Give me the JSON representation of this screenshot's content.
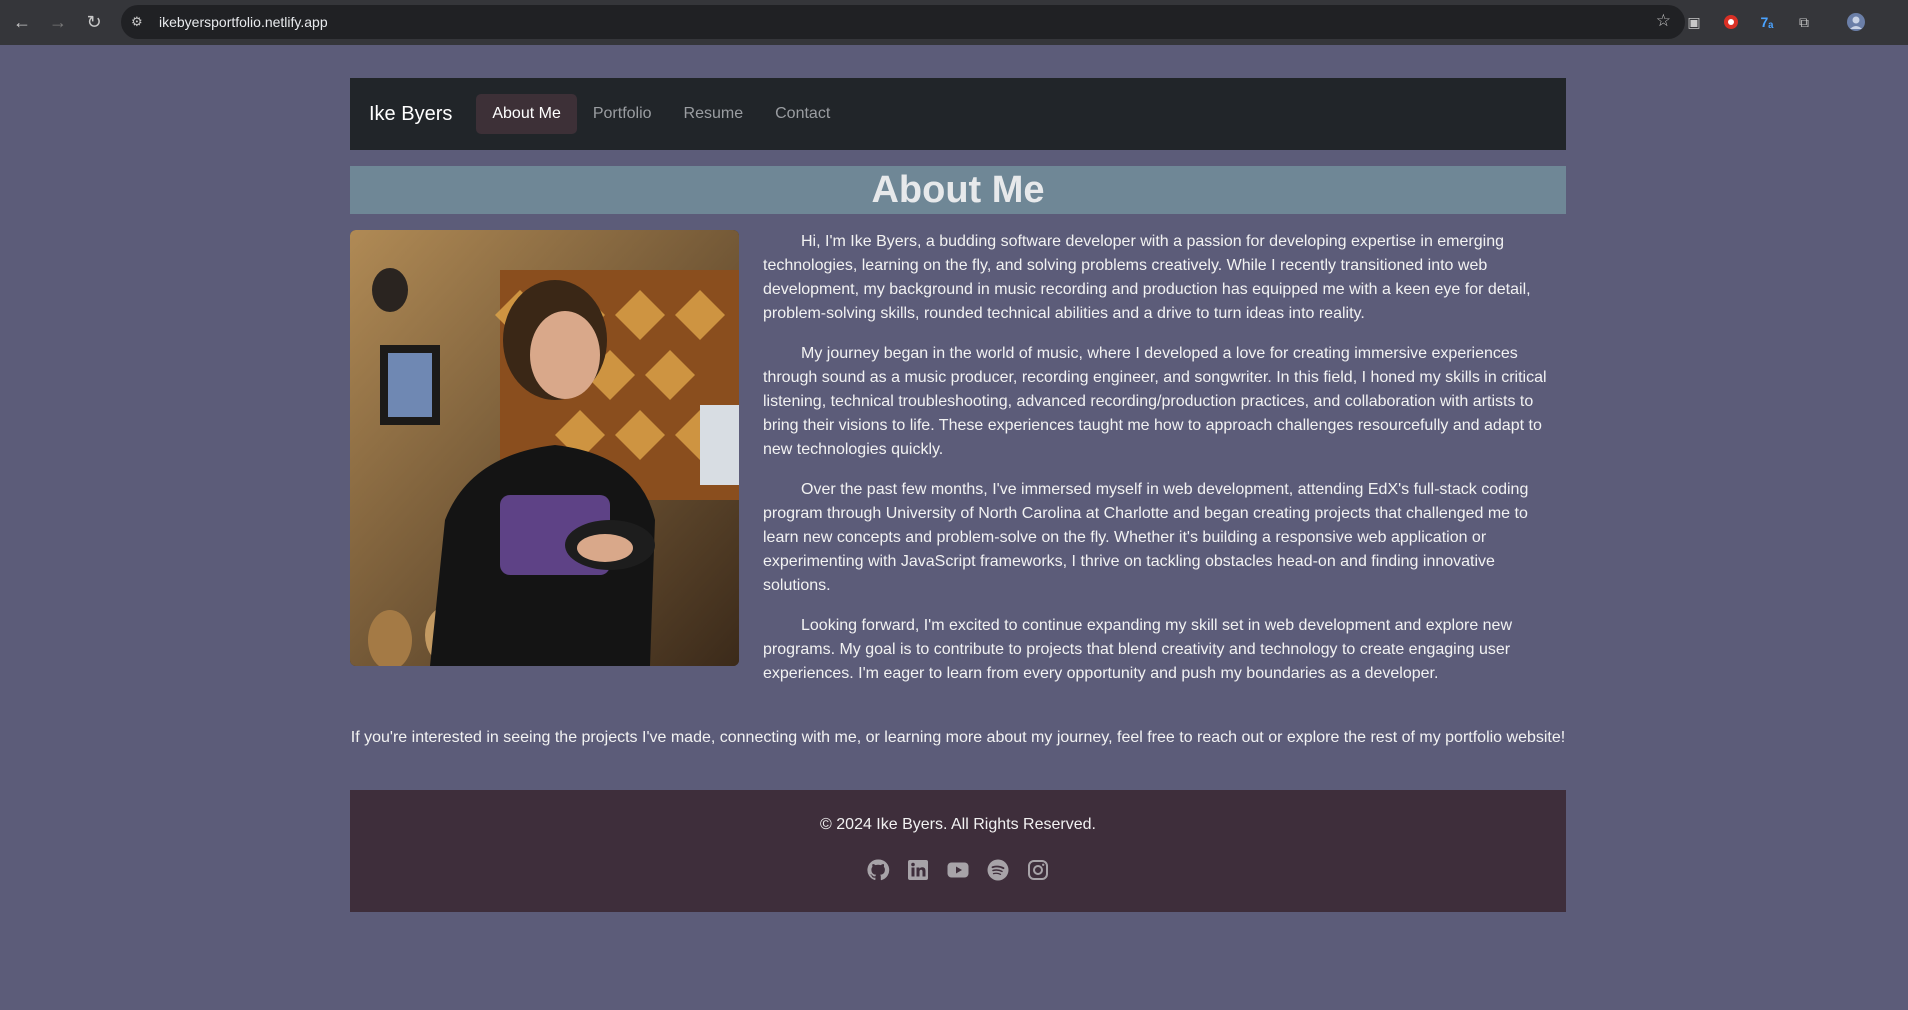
{
  "browser": {
    "url": "ikebyersportfolio.netlify.app"
  },
  "navbar": {
    "brand": "Ike Byers",
    "links": [
      "About Me",
      "Portfolio",
      "Resume",
      "Contact"
    ]
  },
  "page": {
    "heading": "About Me",
    "paragraphs": [
      "Hi, I'm Ike Byers, a budding software developer with a passion for developing expertise in emerging technologies, learning on the fly, and solving problems creatively. While I recently transitioned into web development, my background in music recording and production has equipped me with a keen eye for detail, problem-solving skills, rounded technical abilities and a drive to turn ideas into reality.",
      "My journey began in the world of music, where I developed a love for creating immersive experiences through sound as a music producer, recording engineer, and songwriter. In this field, I honed my skills in critical listening, technical troubleshooting, advanced recording/production practices, and collaboration with artists to bring their visions to life. These experiences taught me how to approach challenges resourcefully and adapt to new technologies quickly.",
      "Over the past few months, I've immersed myself in web development, attending EdX's full-stack coding program through University of North Carolina at Charlotte and began creating projects that challenged me to learn new concepts and problem-solve on the fly. Whether it's building a responsive web application or experimenting with JavaScript frameworks, I thrive on tackling obstacles head-on and finding innovative solutions.",
      "Looking forward, I'm excited to continue expanding my skill set in web development and explore new programs. My goal is to contribute to projects that blend creativity and technology to create engaging user experiences. I'm eager to learn from every opportunity and push my boundaries as a developer."
    ],
    "cta": "If you're interested in seeing the projects I've made, connecting with me, or learning more about my journey, feel free to reach out or explore the rest of my portfolio website!"
  },
  "footer": {
    "copyright": "© 2024 Ike Byers. All Rights Reserved.",
    "social_icons": [
      "github-icon",
      "linkedin-icon",
      "youtube-icon",
      "spotify-icon",
      "instagram-icon"
    ]
  },
  "colors": {
    "page_bg": "#5c5c79",
    "navbar_bg": "#212529",
    "active_link_bg": "#3d3037",
    "heading_bar_bg": "#6f8796",
    "footer_bg": "#3e2e3b"
  }
}
